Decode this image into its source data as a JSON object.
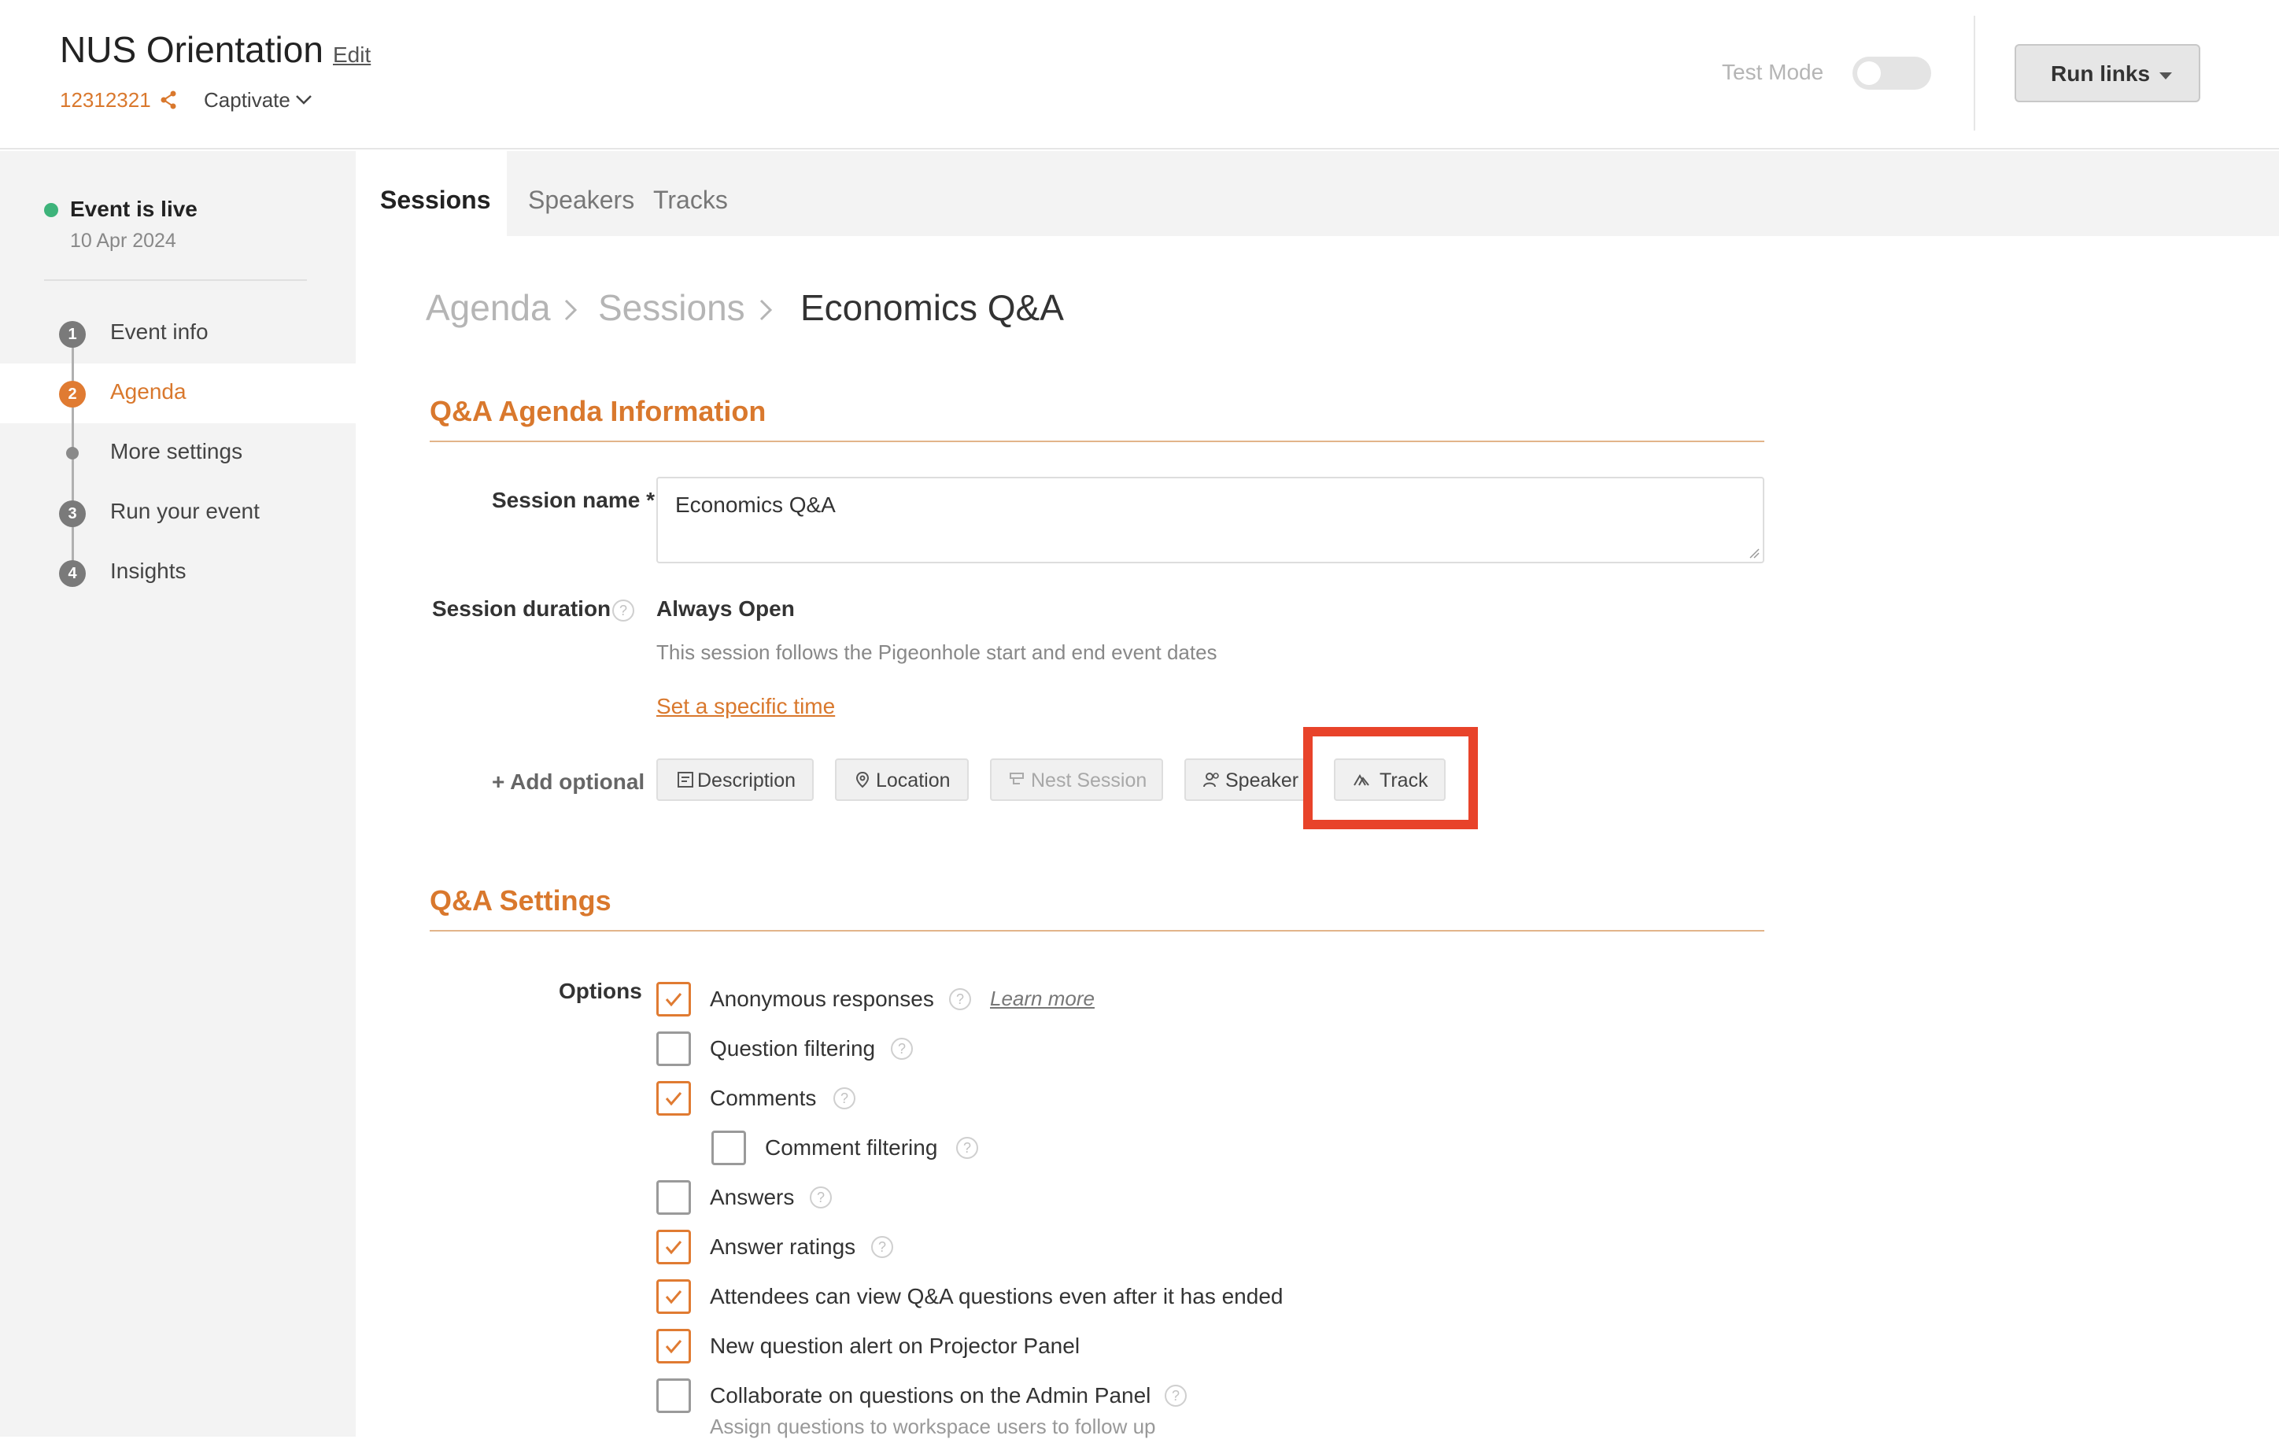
{
  "header": {
    "title": "NUS Orientation",
    "edit_label": "Edit",
    "event_code": "12312321",
    "workspace": "Captivate",
    "test_mode_label": "Test Mode",
    "run_links_label": "Run links"
  },
  "sidebar": {
    "status": "Event is live",
    "date": "10 Apr 2024",
    "steps": [
      {
        "marker": "1",
        "label": "Event info"
      },
      {
        "marker": "2",
        "label": "Agenda"
      },
      {
        "marker": "",
        "label": "More settings"
      },
      {
        "marker": "3",
        "label": "Run your event"
      },
      {
        "marker": "4",
        "label": "Insights"
      }
    ]
  },
  "tabs": [
    "Sessions",
    "Speakers",
    "Tracks"
  ],
  "breadcrumb": [
    "Agenda",
    "Sessions",
    "Economics Q&A"
  ],
  "info_section": {
    "title": "Q&A Agenda Information",
    "session_name_label": "Session name *",
    "session_name_value": "Economics Q&A",
    "duration_label": "Session duration",
    "duration_value": "Always Open",
    "duration_note": "This session follows the Pigeonhole start and end event dates",
    "set_time_link": "Set a specific time",
    "add_optional_label": "+ Add optional",
    "optional_buttons": [
      "Description",
      "Location",
      "Nest Session",
      "Speaker",
      "Track"
    ]
  },
  "settings_section": {
    "title": "Q&A Settings",
    "options_label": "Options",
    "learn_more": "Learn more",
    "options": [
      {
        "label": "Anonymous responses",
        "checked": true
      },
      {
        "label": "Question filtering",
        "checked": false
      },
      {
        "label": "Comments",
        "checked": true
      },
      {
        "label": "Comment filtering",
        "checked": false
      },
      {
        "label": "Answers",
        "checked": false
      },
      {
        "label": "Answer ratings",
        "checked": true
      },
      {
        "label": "Attendees can view Q&A questions even after it has ended",
        "checked": true
      },
      {
        "label": "New question alert on Projector Panel",
        "checked": true
      },
      {
        "label": "Collaborate on questions on the Admin Panel",
        "checked": false
      }
    ],
    "collaborate_note": "Assign questions to workspace users to follow up"
  },
  "colors": {
    "accent": "#d9782d",
    "live": "#3db37a",
    "highlight": "#e8432a"
  }
}
